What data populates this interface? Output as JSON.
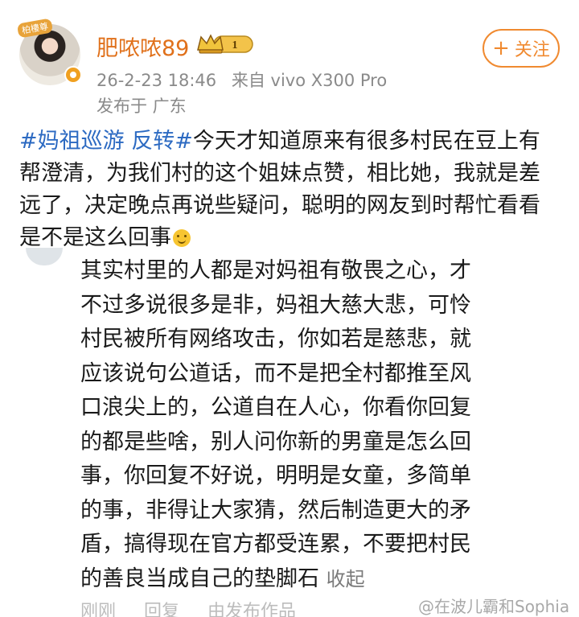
{
  "post": {
    "author": {
      "name": "肥哝哝89",
      "avatar_tag": "柏樓尊",
      "vip_level": "1",
      "verified_icon": "verified-badge-icon"
    },
    "timestamp": "26-2-23 18:46",
    "source": "来自 vivo X300 Pro",
    "location": "发布于 广东",
    "follow_button": {
      "plus": "+",
      "label": "关注"
    },
    "text": {
      "hashtag": "#妈祖巡游 反转#",
      "body": "今天才知道原来有很多村民在豆上有帮澄清，为我们村的这个姐妹点赞，相比她，我就是差远了，决定晚点再说些疑问，聪明的网友到时帮忙看看是不是这么回事",
      "emoji": "smile-emoji"
    }
  },
  "comment": {
    "lines": [
      "其实村里的人都是对妈祖有敬畏之心，才",
      "不过多说很多是非，妈祖大慈大悲，可怜",
      "村民被所有网络攻击，你如若是慈悲，就",
      "应该说句公道话，而不是把全村都推至风",
      "口浪尖上的，公道自在人心，你看你回复",
      "的都是些啥，别人问你新的男童是怎么回",
      "事，你回复不好说，明明是女童，多简单",
      "的事，非得让大家猜，然后制造更大的矛",
      "盾，搞得现在官方都受连累，不要把村民",
      "的善良当成自己的垫脚石"
    ],
    "collapse_label": "收起"
  },
  "bottom_strip": [
    "刚刚",
    "回复",
    "由发布作品"
  ],
  "watermark": "@在波儿霸和Sophia",
  "colors": {
    "username": "#e0701a",
    "hashtag": "#2c6ac2",
    "follow": "#f08a30",
    "meta": "#8a8a8a"
  }
}
